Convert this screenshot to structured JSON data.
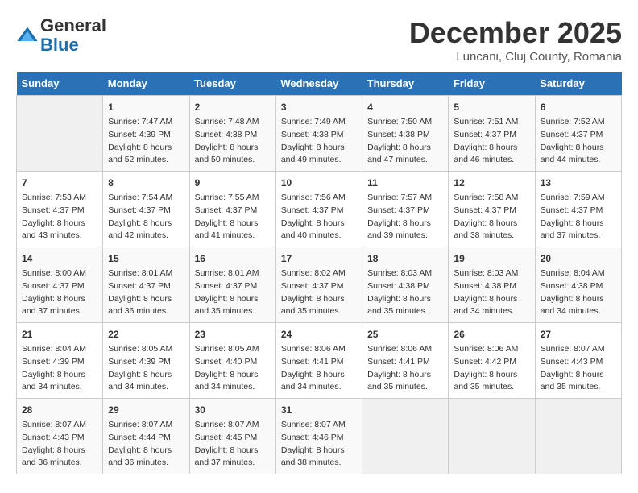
{
  "header": {
    "logo_line1": "General",
    "logo_line2": "Blue",
    "month": "December 2025",
    "location": "Luncani, Cluj County, Romania"
  },
  "days_of_week": [
    "Sunday",
    "Monday",
    "Tuesday",
    "Wednesday",
    "Thursday",
    "Friday",
    "Saturday"
  ],
  "weeks": [
    [
      {
        "day": "",
        "content": ""
      },
      {
        "day": "1",
        "content": "Sunrise: 7:47 AM\nSunset: 4:39 PM\nDaylight: 8 hours\nand 52 minutes."
      },
      {
        "day": "2",
        "content": "Sunrise: 7:48 AM\nSunset: 4:38 PM\nDaylight: 8 hours\nand 50 minutes."
      },
      {
        "day": "3",
        "content": "Sunrise: 7:49 AM\nSunset: 4:38 PM\nDaylight: 8 hours\nand 49 minutes."
      },
      {
        "day": "4",
        "content": "Sunrise: 7:50 AM\nSunset: 4:38 PM\nDaylight: 8 hours\nand 47 minutes."
      },
      {
        "day": "5",
        "content": "Sunrise: 7:51 AM\nSunset: 4:37 PM\nDaylight: 8 hours\nand 46 minutes."
      },
      {
        "day": "6",
        "content": "Sunrise: 7:52 AM\nSunset: 4:37 PM\nDaylight: 8 hours\nand 44 minutes."
      }
    ],
    [
      {
        "day": "7",
        "content": "Sunrise: 7:53 AM\nSunset: 4:37 PM\nDaylight: 8 hours\nand 43 minutes."
      },
      {
        "day": "8",
        "content": "Sunrise: 7:54 AM\nSunset: 4:37 PM\nDaylight: 8 hours\nand 42 minutes."
      },
      {
        "day": "9",
        "content": "Sunrise: 7:55 AM\nSunset: 4:37 PM\nDaylight: 8 hours\nand 41 minutes."
      },
      {
        "day": "10",
        "content": "Sunrise: 7:56 AM\nSunset: 4:37 PM\nDaylight: 8 hours\nand 40 minutes."
      },
      {
        "day": "11",
        "content": "Sunrise: 7:57 AM\nSunset: 4:37 PM\nDaylight: 8 hours\nand 39 minutes."
      },
      {
        "day": "12",
        "content": "Sunrise: 7:58 AM\nSunset: 4:37 PM\nDaylight: 8 hours\nand 38 minutes."
      },
      {
        "day": "13",
        "content": "Sunrise: 7:59 AM\nSunset: 4:37 PM\nDaylight: 8 hours\nand 37 minutes."
      }
    ],
    [
      {
        "day": "14",
        "content": "Sunrise: 8:00 AM\nSunset: 4:37 PM\nDaylight: 8 hours\nand 37 minutes."
      },
      {
        "day": "15",
        "content": "Sunrise: 8:01 AM\nSunset: 4:37 PM\nDaylight: 8 hours\nand 36 minutes."
      },
      {
        "day": "16",
        "content": "Sunrise: 8:01 AM\nSunset: 4:37 PM\nDaylight: 8 hours\nand 35 minutes."
      },
      {
        "day": "17",
        "content": "Sunrise: 8:02 AM\nSunset: 4:37 PM\nDaylight: 8 hours\nand 35 minutes."
      },
      {
        "day": "18",
        "content": "Sunrise: 8:03 AM\nSunset: 4:38 PM\nDaylight: 8 hours\nand 35 minutes."
      },
      {
        "day": "19",
        "content": "Sunrise: 8:03 AM\nSunset: 4:38 PM\nDaylight: 8 hours\nand 34 minutes."
      },
      {
        "day": "20",
        "content": "Sunrise: 8:04 AM\nSunset: 4:38 PM\nDaylight: 8 hours\nand 34 minutes."
      }
    ],
    [
      {
        "day": "21",
        "content": "Sunrise: 8:04 AM\nSunset: 4:39 PM\nDaylight: 8 hours\nand 34 minutes."
      },
      {
        "day": "22",
        "content": "Sunrise: 8:05 AM\nSunset: 4:39 PM\nDaylight: 8 hours\nand 34 minutes."
      },
      {
        "day": "23",
        "content": "Sunrise: 8:05 AM\nSunset: 4:40 PM\nDaylight: 8 hours\nand 34 minutes."
      },
      {
        "day": "24",
        "content": "Sunrise: 8:06 AM\nSunset: 4:41 PM\nDaylight: 8 hours\nand 34 minutes."
      },
      {
        "day": "25",
        "content": "Sunrise: 8:06 AM\nSunset: 4:41 PM\nDaylight: 8 hours\nand 35 minutes."
      },
      {
        "day": "26",
        "content": "Sunrise: 8:06 AM\nSunset: 4:42 PM\nDaylight: 8 hours\nand 35 minutes."
      },
      {
        "day": "27",
        "content": "Sunrise: 8:07 AM\nSunset: 4:43 PM\nDaylight: 8 hours\nand 35 minutes."
      }
    ],
    [
      {
        "day": "28",
        "content": "Sunrise: 8:07 AM\nSunset: 4:43 PM\nDaylight: 8 hours\nand 36 minutes."
      },
      {
        "day": "29",
        "content": "Sunrise: 8:07 AM\nSunset: 4:44 PM\nDaylight: 8 hours\nand 36 minutes."
      },
      {
        "day": "30",
        "content": "Sunrise: 8:07 AM\nSunset: 4:45 PM\nDaylight: 8 hours\nand 37 minutes."
      },
      {
        "day": "31",
        "content": "Sunrise: 8:07 AM\nSunset: 4:46 PM\nDaylight: 8 hours\nand 38 minutes."
      },
      {
        "day": "",
        "content": ""
      },
      {
        "day": "",
        "content": ""
      },
      {
        "day": "",
        "content": ""
      }
    ]
  ]
}
